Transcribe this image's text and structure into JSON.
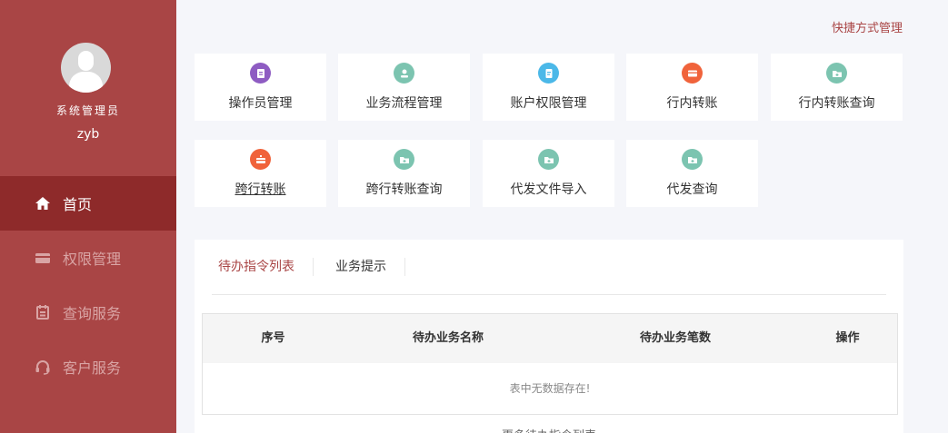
{
  "sidebar": {
    "role": "系统管理员",
    "username": "zyb",
    "items": [
      {
        "label": "首页",
        "icon": "home-icon",
        "active": true
      },
      {
        "label": "权限管理",
        "icon": "card-icon",
        "active": false
      },
      {
        "label": "查询服务",
        "icon": "calendar-icon",
        "active": false
      },
      {
        "label": "客户服务",
        "icon": "headset-icon",
        "active": false
      }
    ]
  },
  "header": {
    "shortcut_manage": "快捷方式管理"
  },
  "tiles": [
    {
      "label": "操作员管理",
      "color": "#8e5cc2",
      "icon": "operator-icon"
    },
    {
      "label": "业务流程管理",
      "color": "#7cc4b0",
      "icon": "flow-icon"
    },
    {
      "label": "账户权限管理",
      "color": "#4bb8e8",
      "icon": "document-icon"
    },
    {
      "label": "行内转账",
      "color": "#f0633b",
      "icon": "card-icon"
    },
    {
      "label": "行内转账查询",
      "color": "#7cc4b0",
      "icon": "folder-icon"
    },
    {
      "label": "跨行转账",
      "color": "#f0633b",
      "icon": "transfer-icon"
    },
    {
      "label": "跨行转账查询",
      "color": "#7cc4b0",
      "icon": "folder-icon"
    },
    {
      "label": "代发文件导入",
      "color": "#7cc4b0",
      "icon": "folder-icon"
    },
    {
      "label": "代发查询",
      "color": "#7cc4b0",
      "icon": "folder-icon"
    }
  ],
  "panel": {
    "tabs": [
      "待办指令列表",
      "业务提示"
    ],
    "columns": [
      "序号",
      "待办业务名称",
      "待办业务笔数",
      "操作"
    ],
    "empty_text": "表中无数据存在!",
    "more_link": "更多待办指令列表"
  },
  "colors": {
    "sidebar": "#a94545",
    "sidebar_active": "#8e2a2a",
    "accent": "#a94545"
  }
}
